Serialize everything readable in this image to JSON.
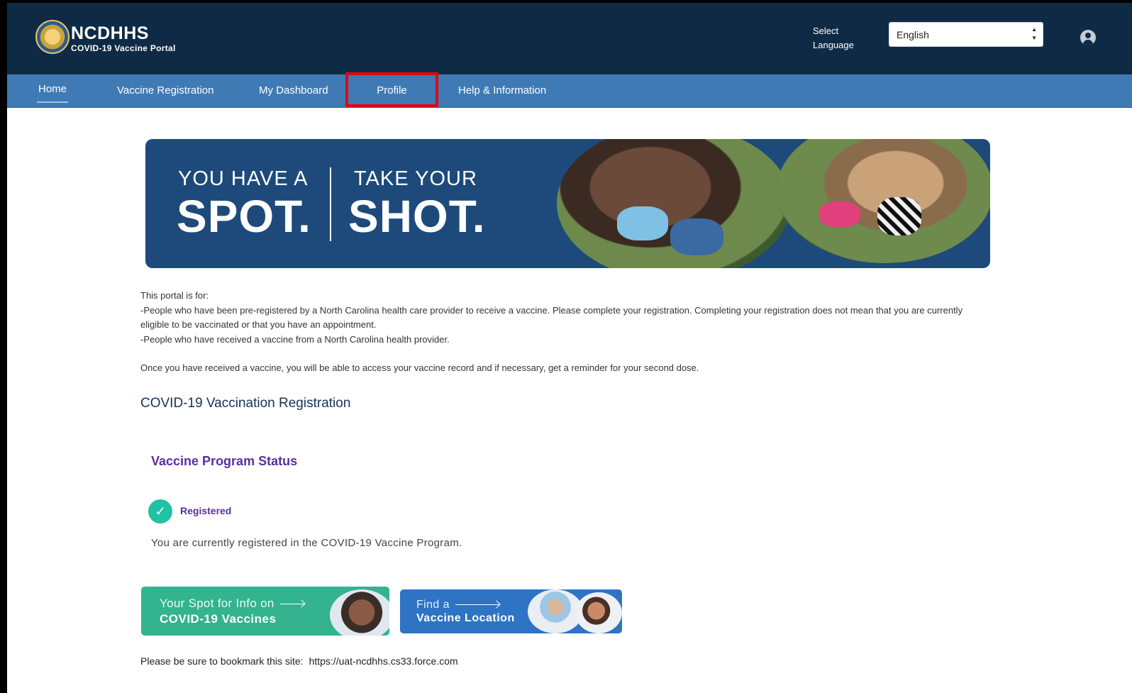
{
  "header": {
    "brand_title": "NCDHHS",
    "brand_subtitle": "COVID-19 Vaccine Portal",
    "language_label_line1": "Select",
    "language_label_line2": "Language",
    "language_selected": "English",
    "colors": {
      "header_bg": "#0f2a45",
      "nav_bg": "#3f7ab5",
      "highlight": "#e30613"
    }
  },
  "nav": {
    "items": [
      {
        "label": "Home"
      },
      {
        "label": "Vaccine Registration"
      },
      {
        "label": "My Dashboard"
      },
      {
        "label": "Profile"
      },
      {
        "label": "Help & Information"
      }
    ]
  },
  "banner": {
    "left_line1": "YOU HAVE A",
    "left_line2": "SPOT.",
    "right_line1": "TAKE YOUR",
    "right_line2": "SHOT."
  },
  "intro": {
    "line1": "This portal is for:",
    "line2": "-People who have been pre-registered by a North Carolina health care provider to receive a vaccine. Please complete your registration. Completing your registration does not mean that you are currently eligible to be vaccinated or that you have an appointment.",
    "line3": "-People who have received a vaccine from a North Carolina health provider.",
    "line4": "Once you have received a vaccine, you will be able to access your vaccine record and if necessary, get a reminder for your second dose."
  },
  "registration": {
    "section_title": "COVID-19 Vaccination Registration",
    "status_title": "Vaccine Program Status",
    "status_label": "Registered",
    "status_description": "You are currently registered in the COVID-19 Vaccine Program."
  },
  "promo": {
    "info_line1": "Your Spot for Info on",
    "info_line2": "COVID-19 Vaccines",
    "location_line1": "Find a",
    "location_line2": "Vaccine Location"
  },
  "footer": {
    "bookmark_text": "Please be sure to bookmark this site:",
    "bookmark_url": "https://uat-ncdhhs.cs33.force.com"
  }
}
